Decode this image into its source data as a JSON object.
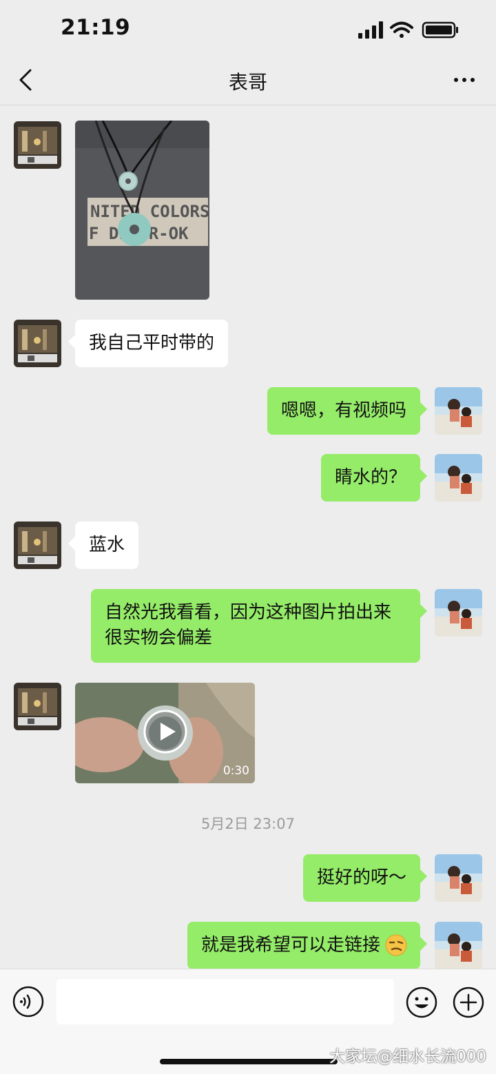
{
  "status_bar": {
    "time": "21:19"
  },
  "nav": {
    "title": "表哥"
  },
  "messages": [
    {
      "side": "in",
      "type": "image"
    },
    {
      "side": "in",
      "type": "text",
      "text": "我自己平时带的"
    },
    {
      "side": "out",
      "type": "text",
      "text": "嗯嗯，有视频吗"
    },
    {
      "side": "out",
      "type": "text",
      "text": "睛水的？"
    },
    {
      "side": "in",
      "type": "text",
      "text": "蓝水"
    },
    {
      "side": "out",
      "type": "text",
      "text": "自然光我看看，因为这种图片拍出来很实物会偏差"
    },
    {
      "side": "in",
      "type": "video",
      "duration": "0:30"
    },
    {
      "side": "out",
      "type": "text",
      "text": "挺好的呀～"
    },
    {
      "side": "out",
      "type": "text",
      "text": "就是我希望可以走链接"
    }
  ],
  "timestamp": "5月2日 23:07",
  "watermark": "大家坛@细水长流000"
}
